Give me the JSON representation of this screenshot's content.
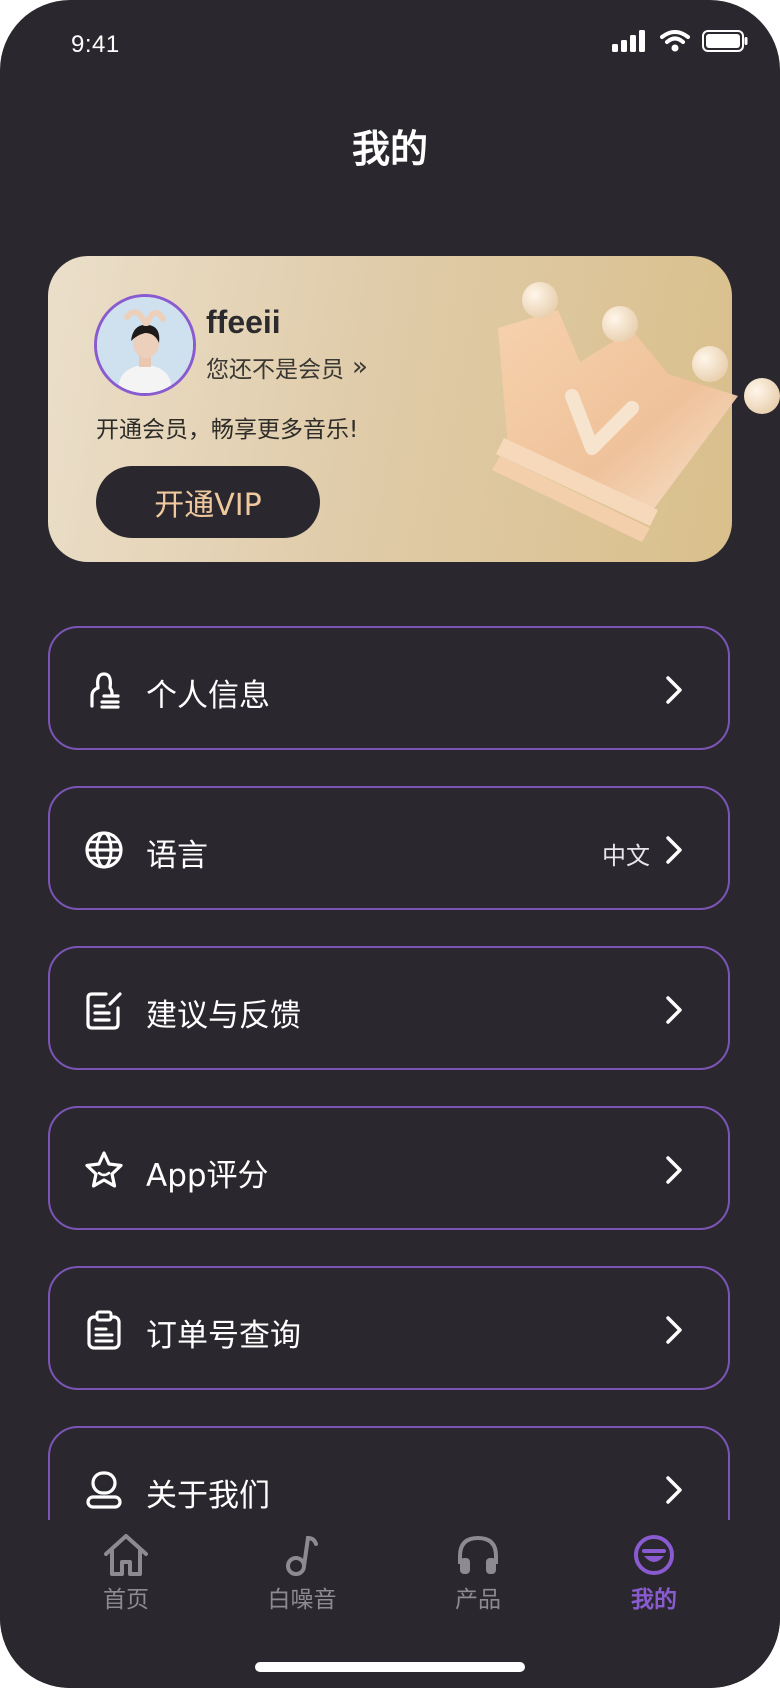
{
  "status_bar": {
    "time": "9:41"
  },
  "page": {
    "title": "我的"
  },
  "vip_card": {
    "username": "ffeeii",
    "member_status": "您还不是会员",
    "member_status_arrow": "»",
    "promo_text": "开通会员，畅享更多音乐!",
    "cta_label": "开通VIP",
    "cta_color": "#f0c89d",
    "accent_color": "#8a5bd0"
  },
  "menu": [
    {
      "label": "个人信息",
      "icon": "person-icon",
      "value": ""
    },
    {
      "label": "语言",
      "icon": "globe-icon",
      "value": "中文"
    },
    {
      "label": "建议与反馈",
      "icon": "feedback-icon",
      "value": ""
    },
    {
      "label": "App评分",
      "icon": "star-icon",
      "value": ""
    },
    {
      "label": "订单号查询",
      "icon": "clipboard-icon",
      "value": ""
    },
    {
      "label": "关于我们",
      "icon": "user-circle-icon",
      "value": ""
    }
  ],
  "tabbar": {
    "active_color": "#8a5bd0",
    "inactive_color": "#8d8b90",
    "tabs": [
      {
        "label": "首页",
        "icon": "home-icon",
        "active": false
      },
      {
        "label": "白噪音",
        "icon": "music-note-icon",
        "active": false
      },
      {
        "label": "产品",
        "icon": "headphones-icon",
        "active": false
      },
      {
        "label": "我的",
        "icon": "profile-smile-icon",
        "active": true
      }
    ]
  }
}
